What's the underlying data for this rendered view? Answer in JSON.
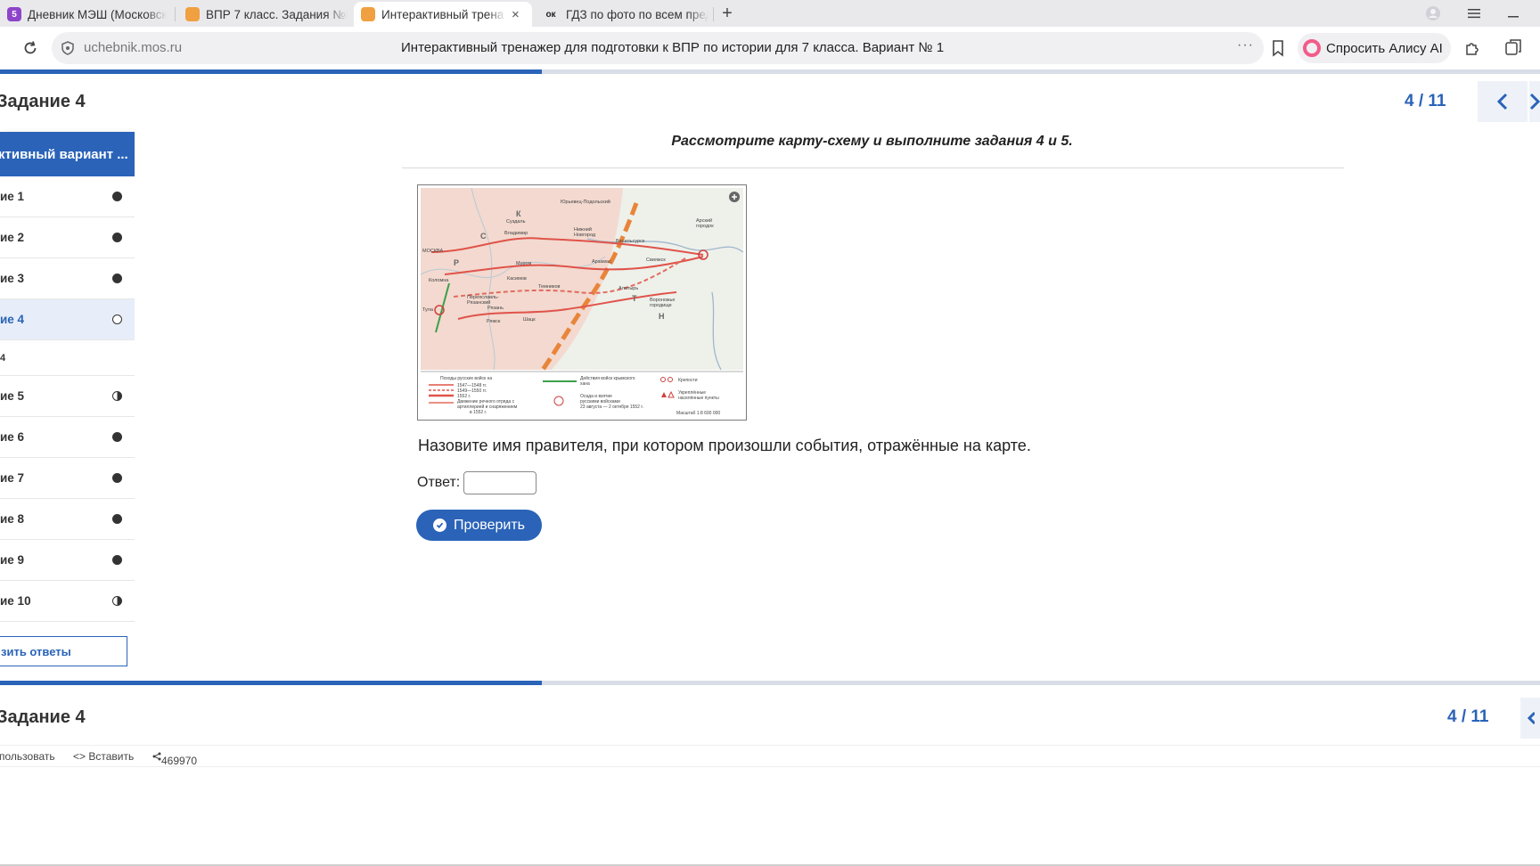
{
  "browser": {
    "tabs": [
      {
        "title": "Дневник МЭШ (Московск",
        "favicon": "5",
        "favicon_color": "#8e44c9",
        "active": false
      },
      {
        "title": "ВПР 7 класс. Задания №8",
        "favicon": "",
        "favicon_color": "#f0a040",
        "active": false
      },
      {
        "title": "Интерактивный трена",
        "favicon": "",
        "favicon_color": "#f0a040",
        "active": true,
        "close": "×"
      },
      {
        "title": "ГДЗ по фото по всем пред",
        "favicon": "ок",
        "favicon_color": "#222222",
        "active": false
      }
    ],
    "new_tab": "+",
    "address": {
      "domain": "uchebnik.mos.ru",
      "page_title": "Интерактивный тренажер для подготовки к ВПР по истории для 7 класса. Вариант № 1",
      "dots": "···"
    },
    "alice_button": "Спросить Алису AI"
  },
  "progress": {
    "fraction": 0.352
  },
  "task_header": {
    "title": "Задание 4",
    "counter": "4 / 11"
  },
  "sidebar": {
    "header": "ктивный вариант ...",
    "items": [
      {
        "label": "ие 1",
        "status": "full"
      },
      {
        "label": "ие 2",
        "status": "full"
      },
      {
        "label": "ие 3",
        "status": "full"
      },
      {
        "label": "ие 4",
        "status": "empty",
        "active": true
      },
      {
        "label": "ие 5",
        "status": "half"
      },
      {
        "label": "ие 6",
        "status": "full"
      },
      {
        "label": "ие 7",
        "status": "full"
      },
      {
        "label": "ие 8",
        "status": "full"
      },
      {
        "label": "ие 9",
        "status": "full"
      },
      {
        "label": "ие 10",
        "status": "half"
      }
    ],
    "sub_label": "4",
    "submit_button": "зить ответы"
  },
  "content": {
    "instruction": "Рассмотрите карту-схему и выполните задания 4 и 5.",
    "question": "Назовите имя правителя, при котором произошли события, отражённые на карте.",
    "answer_label": "Ответ:",
    "answer_value": "",
    "check_button": "Проверить"
  },
  "map": {
    "places": [
      "Юрьевец-Подольский",
      "Суздаль",
      "Владимир",
      "Нижний Новгород",
      "Москва",
      "Коломна",
      "Муром",
      "Касимов",
      "Каширa",
      "Переяславль-Рязанский",
      "Рязань",
      "Темников",
      "Арзамас",
      "Алатырь",
      "Васильсурск",
      "Свияжск",
      "Арский городок",
      "Тула",
      "Ряжск",
      "Шацк",
      "Вороножье городище"
    ],
    "legend": [
      "Походы русских войск на",
      "1547—1548 гг.",
      "1549—1550 гг.",
      "1552 г.",
      "Движение речного отряда с артиллерией и снаряжением в 1552 г.",
      "Действия войск крымского хана",
      "Осада и взятие русскими войсками 23 августа — 2 октября 1552 г.",
      "Крепости",
      "Укреплённые населённые пункты",
      "Масштаб 1:8 600 000"
    ]
  },
  "footer": {
    "title": "Задание 4",
    "counter": "4 / 11",
    "links": [
      "пользовать",
      "<> Вставить",
      "469970"
    ]
  },
  "colors": {
    "accent": "#2a63b8",
    "accent_light": "#e7eef9",
    "map_land": "#f3d9cf",
    "map_route": "#e0534a"
  }
}
